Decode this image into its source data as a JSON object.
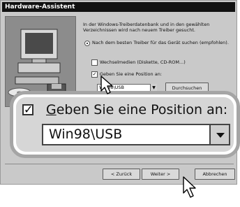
{
  "window": {
    "title": "Hardware-Assistent"
  },
  "intro_text": "In der Windows-Treiberdatenbank und in den gewählten Verzeichnissen wird nach neuem Treiber gesucht.",
  "options": {
    "best_driver": "Nach dem besten Treiber für das Gerät suchen (empfohlen).",
    "removable_media": "Wechselmedien (Diskette, CD-ROM...)",
    "specify_location": "Geben Sie eine Position an:"
  },
  "location": {
    "value": "Win98\\USB"
  },
  "buttons": {
    "browse": "Durchsuchen",
    "back": "< Zurück",
    "next": "Weiter >",
    "cancel": "Abbrechen"
  },
  "zoom": {
    "label_prefix": "G",
    "label_rest": "eben Sie eine Position an:",
    "value": "Win98\\USB"
  }
}
